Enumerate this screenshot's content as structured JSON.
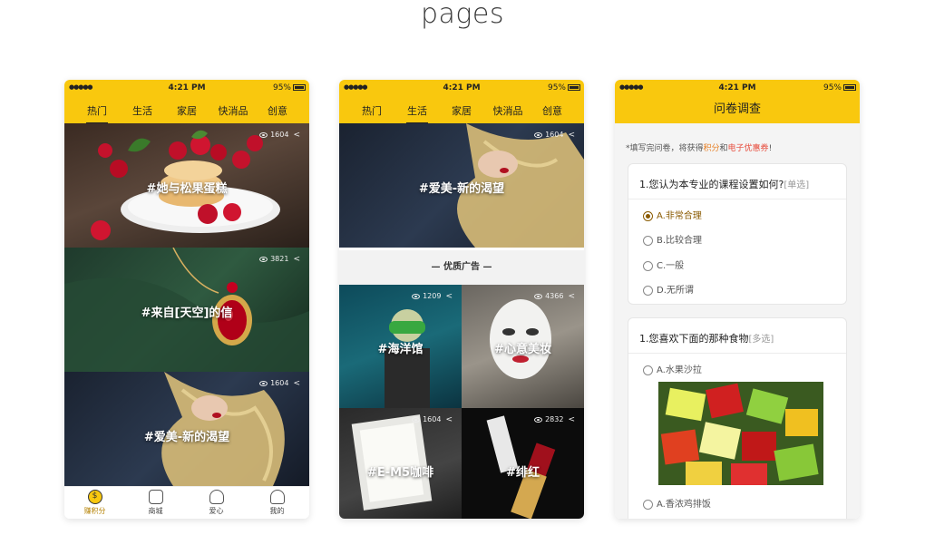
{
  "heading": "pages",
  "status": {
    "signal": "●●●●● ",
    "time": "4:21 PM",
    "battery": "95%"
  },
  "phone1": {
    "tabs": [
      "热门",
      "生活",
      "家居",
      "快消品",
      "创意"
    ],
    "cards": [
      {
        "caption": "#她与松果蛋糕",
        "views": "1604"
      },
      {
        "caption": "#来自[天空]的信",
        "views": "3821"
      },
      {
        "caption": "#爱美-新的渴望",
        "views": "1604"
      }
    ],
    "nav": [
      "赚积分",
      "商城",
      "爱心",
      "我的"
    ]
  },
  "phone2": {
    "tabs": [
      "热门",
      "生活",
      "家居",
      "快消品",
      "创意"
    ],
    "hero": {
      "caption": "#爱美-新的渴望",
      "views": "1604"
    },
    "ad_label": "— 优质广告 —",
    "grid": [
      {
        "caption": "#海洋馆",
        "views": "1209"
      },
      {
        "caption": "#心意美妆",
        "views": "4366"
      },
      {
        "caption": "#E-M5咖啡",
        "views": "1604"
      },
      {
        "caption": "#绯红",
        "views": "2832"
      }
    ]
  },
  "phone3": {
    "title": "问卷调查",
    "notice": {
      "prefix": "*填写完问卷，将获得",
      "points": "积分",
      "and": "和",
      "coupon": "电子优惠券",
      "suffix": "!"
    },
    "q1": {
      "title": "1.您认为本专业的课程设置如何?",
      "tag": "[单选]",
      "options": [
        "A.非常合理",
        "B.比较合理",
        "C.一般",
        "D.无所谓"
      ]
    },
    "q2": {
      "title": "1.您喜欢下面的那种食物",
      "tag": "[多选]",
      "options": [
        "A.水果沙拉",
        "A.香浓鸡排饭"
      ]
    }
  },
  "colors": {
    "accent": "#f9c80e"
  },
  "icons": [
    "eye-icon",
    "share-icon",
    "coin-icon",
    "bag-icon",
    "heart-hand-icon",
    "user-icon"
  ]
}
